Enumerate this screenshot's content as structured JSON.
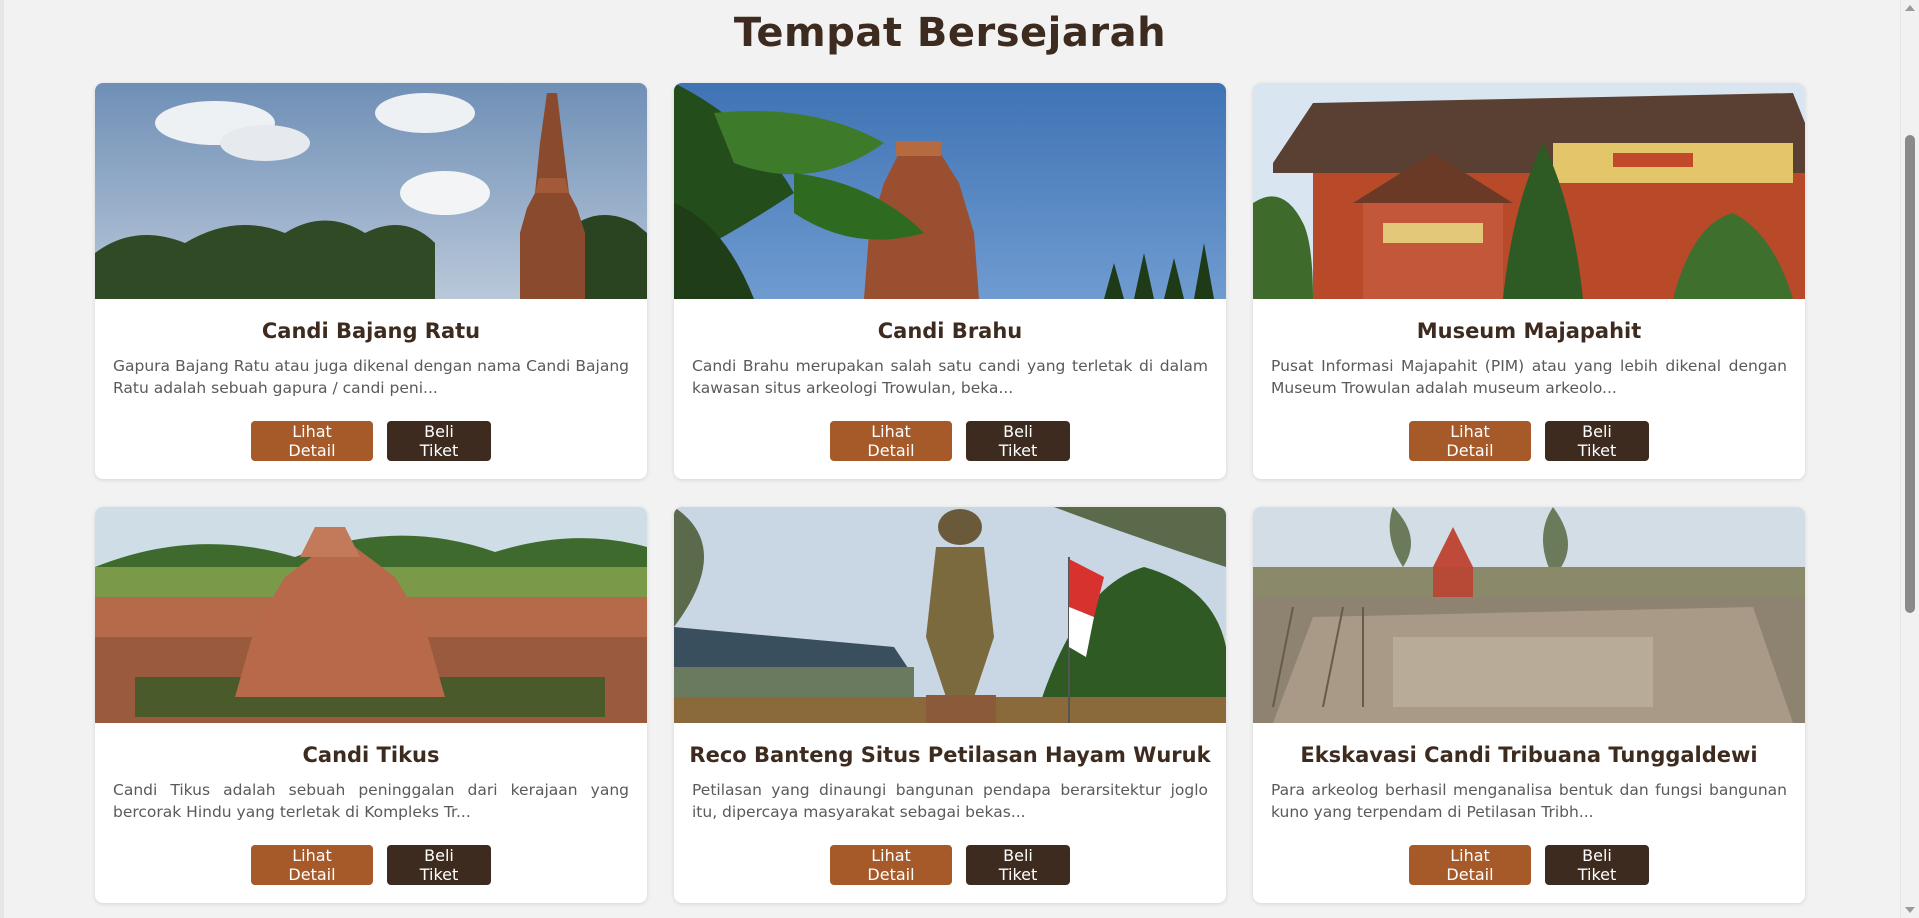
{
  "page": {
    "title": "Tempat Bersejarah"
  },
  "colors": {
    "primary_brown": "#3d2b1f",
    "accent_orange": "#a65a2a",
    "background": "#f2f2f2"
  },
  "cards": [
    {
      "title": "Candi Bajang Ratu",
      "description": "Gapura Bajang Ratu atau juga dikenal dengan nama Candi Bajang Ratu adalah sebuah gapura / candi peni...",
      "detail_label": "Lihat Detail",
      "ticket_label": "Beli Tiket"
    },
    {
      "title": "Candi Brahu",
      "description": "Candi Brahu merupakan salah satu candi yang terletak di dalam kawasan situs arkeologi Trowulan, beka...",
      "detail_label": "Lihat Detail",
      "ticket_label": "Beli Tiket"
    },
    {
      "title": "Museum Majapahit",
      "description": "Pusat Informasi Majapahit (PIM) atau yang lebih dikenal dengan Museum Trowulan adalah museum arkeolo...",
      "detail_label": "Lihat Detail",
      "ticket_label": "Beli Tiket"
    },
    {
      "title": "Candi Tikus",
      "description": "Candi Tikus adalah sebuah peninggalan dari kerajaan yang bercorak Hindu yang terletak di Kompleks Tr...",
      "detail_label": "Lihat Detail",
      "ticket_label": "Beli Tiket"
    },
    {
      "title": "Reco Banteng Situs Petilasan Hayam Wuruk",
      "description": "Petilasan yang dinaungi bangunan pendapa berarsitektur joglo itu, dipercaya masyarakat sebagai bekas...",
      "detail_label": "Lihat Detail",
      "ticket_label": "Beli Tiket"
    },
    {
      "title": "Ekskavasi Candi Tribuana Tunggaldewi",
      "description": "Para arkeolog berhasil menganalisa bentuk dan fungsi bangunan kuno yang terpendam di Petilasan Tribh...",
      "detail_label": "Lihat Detail",
      "ticket_label": "Beli Tiket"
    }
  ]
}
